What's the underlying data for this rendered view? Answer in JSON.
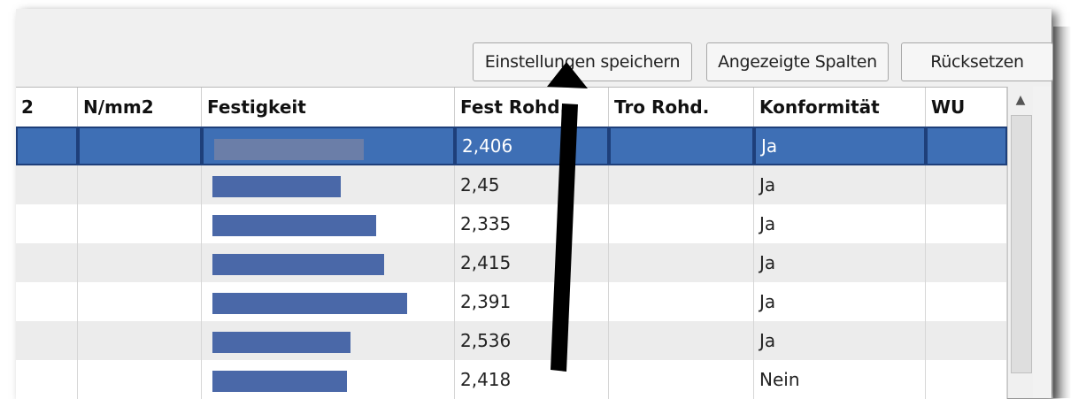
{
  "toolbar": {
    "save_settings": "Einstellungen speichern",
    "shown_columns": "Angezeigte Spalten",
    "reset": "Rücksetzen"
  },
  "table": {
    "headers": [
      "2",
      "N/mm2",
      "Festigkeit",
      "Fest Rohd.",
      "Tro Rohd.",
      "Konformität",
      "WU"
    ],
    "rows": [
      {
        "fest_rohd": "2,406",
        "konformitaet": "Ja",
        "festigkeit_level": 0.77,
        "selected": true
      },
      {
        "fest_rohd": "2,45",
        "konformitaet": "Ja",
        "festigkeit_level": 0.66
      },
      {
        "fest_rohd": "2,335",
        "konformitaet": "Ja",
        "festigkeit_level": 0.84
      },
      {
        "fest_rohd": "2,415",
        "konformitaet": "Ja",
        "festigkeit_level": 0.88
      },
      {
        "fest_rohd": "2,391",
        "konformitaet": "Ja",
        "festigkeit_level": 1.0
      },
      {
        "fest_rohd": "2,536",
        "konformitaet": "Ja",
        "festigkeit_level": 0.71
      },
      {
        "fest_rohd": "2,418",
        "konformitaet": "Nein",
        "festigkeit_level": 0.69
      }
    ]
  },
  "colors": {
    "selection": "#3e6fb5",
    "bar": "#4a68a8",
    "alt_row": "#ececec"
  },
  "icons": {
    "scroll_up": "triangle-up-icon",
    "annotation": "black-arrow-icon"
  }
}
